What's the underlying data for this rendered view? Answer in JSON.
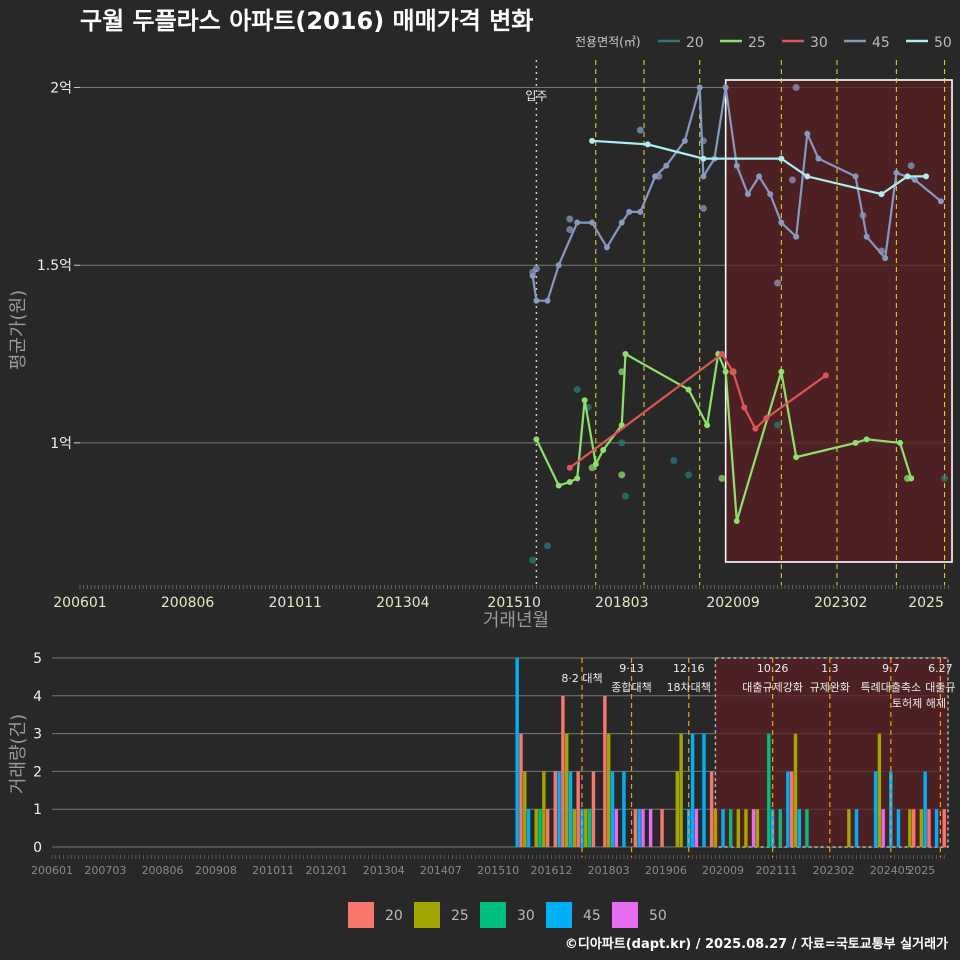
{
  "title": "구월 두플라스 아파트(2016) 매매가격 변화",
  "footer": "©디아파트(dapt.kr) / 2025.08.27 / 자료=국토교통부 실거래가",
  "colors": {
    "20": "#2a7a78",
    "25": "#8ee06a",
    "30": "#e05555",
    "45": "#8899c0",
    "50": "#aeeeee"
  },
  "bar_colors": {
    "20": "#f8766d",
    "25": "#a3a500",
    "30": "#00bf7d",
    "45": "#00b0f6",
    "50": "#e76bf3"
  },
  "chart_data": [
    {
      "type": "line",
      "title": "구월 두플라스 아파트(2016) 매매가격 변화",
      "xlabel": "거래년월",
      "ylabel": "평균가(원)",
      "x_ticks": [
        "200601",
        "200806",
        "201011",
        "201304",
        "201510",
        "201803",
        "202009",
        "202302",
        "2025"
      ],
      "y_ticks": [
        {
          "v": 1.0,
          "label": "1억"
        },
        {
          "v": 1.5,
          "label": "1.5억"
        },
        {
          "v": 2.0,
          "label": "2억"
        }
      ],
      "ylim": [
        0.6,
        2.1
      ],
      "legend": {
        "title": "전용면적(㎡)",
        "entries": [
          "20",
          "25",
          "30",
          "45",
          "50"
        ],
        "position": "top-right"
      },
      "annotation": {
        "label": "입주",
        "x": "2016-04"
      },
      "highlight_range": [
        "2020-07",
        "2025-08"
      ],
      "policy_lines": [
        "2017-08",
        "2018-09",
        "2019-12",
        "2021-10",
        "2023-01",
        "2024-05",
        "2025-06"
      ],
      "series": [
        {
          "name": "45",
          "points": [
            [
              "2016-03",
              1.47
            ],
            [
              "2016-04",
              1.4
            ],
            [
              "2016-07",
              1.4
            ],
            [
              "2016-10",
              1.5
            ],
            [
              "2017-03",
              1.62
            ],
            [
              "2017-07",
              1.62
            ],
            [
              "2017-11",
              1.55
            ],
            [
              "2018-03",
              1.62
            ],
            [
              "2018-05",
              1.65
            ],
            [
              "2018-08",
              1.65
            ],
            [
              "2018-12",
              1.75
            ],
            [
              "2019-03",
              1.78
            ],
            [
              "2019-08",
              1.85
            ],
            [
              "2019-12",
              2.0
            ],
            [
              "2020-01",
              1.75
            ],
            [
              "2020-04",
              1.8
            ],
            [
              "2020-07",
              2.0
            ],
            [
              "2020-10",
              1.78
            ],
            [
              "2021-01",
              1.7
            ],
            [
              "2021-04",
              1.75
            ],
            [
              "2021-07",
              1.7
            ],
            [
              "2021-10",
              1.62
            ],
            [
              "2022-02",
              1.58
            ],
            [
              "2022-05",
              1.87
            ],
            [
              "2022-08",
              1.8
            ],
            [
              "2023-06",
              1.75
            ],
            [
              "2023-09",
              1.58
            ],
            [
              "2024-02",
              1.52
            ],
            [
              "2024-05",
              1.76
            ],
            [
              "2024-10",
              1.74
            ],
            [
              "2025-05",
              1.68
            ]
          ]
        },
        {
          "name": "50",
          "points": [
            [
              "2017-07",
              1.85
            ],
            [
              "2018-10",
              1.84
            ],
            [
              "2020-01",
              1.8
            ],
            [
              "2021-10",
              1.8
            ],
            [
              "2022-05",
              1.75
            ],
            [
              "2024-01",
              1.7
            ],
            [
              "2024-08",
              1.75
            ],
            [
              "2025-01",
              1.75
            ]
          ]
        },
        {
          "name": "25",
          "points": [
            [
              "2016-04",
              1.01
            ],
            [
              "2016-10",
              0.88
            ],
            [
              "2017-01",
              0.89
            ],
            [
              "2017-03",
              0.9
            ],
            [
              "2017-05",
              1.12
            ],
            [
              "2017-08",
              0.94
            ],
            [
              "2017-10",
              0.98
            ],
            [
              "2018-03",
              1.05
            ],
            [
              "2018-04",
              1.25
            ],
            [
              "2019-09",
              1.15
            ],
            [
              "2020-02",
              1.05
            ],
            [
              "2020-05",
              1.25
            ],
            [
              "2020-07",
              1.2
            ],
            [
              "2020-10",
              0.78
            ],
            [
              "2021-10",
              1.2
            ],
            [
              "2022-02",
              0.96
            ],
            [
              "2023-06",
              1.0
            ],
            [
              "2023-09",
              1.01
            ],
            [
              "2024-06",
              1.0
            ],
            [
              "2024-09",
              0.9
            ]
          ]
        },
        {
          "name": "30",
          "points": [
            [
              "2017-01",
              0.93
            ],
            [
              "2020-06",
              1.25
            ],
            [
              "2020-09",
              1.2
            ],
            [
              "2020-12",
              1.1
            ],
            [
              "2021-03",
              1.04
            ],
            [
              "2021-06",
              1.07
            ],
            [
              "2022-10",
              1.19
            ]
          ]
        }
      ],
      "scatter_points": [
        [
          "2016-03",
          0.67,
          "20"
        ],
        [
          "2016-07",
          0.71,
          "20"
        ],
        [
          "2017-03",
          1.15,
          "20"
        ],
        [
          "2017-06",
          1.1,
          "20"
        ],
        [
          "2018-03",
          1.0,
          "20"
        ],
        [
          "2018-04",
          0.85,
          "20"
        ],
        [
          "2019-05",
          0.95,
          "20"
        ],
        [
          "2019-09",
          0.91,
          "20"
        ],
        [
          "2021-09",
          1.05,
          "20"
        ],
        [
          "2025-06",
          0.9,
          "20"
        ],
        [
          "2017-07",
          0.93,
          "25"
        ],
        [
          "2018-03",
          0.91,
          "25"
        ],
        [
          "2018-03",
          1.2,
          "25"
        ],
        [
          "2020-06",
          0.9,
          "25"
        ],
        [
          "2020-09",
          1.2,
          "25"
        ],
        [
          "2024-08",
          0.9,
          "25"
        ],
        [
          "2016-03",
          1.48,
          "45"
        ],
        [
          "2016-04",
          1.49,
          "45"
        ],
        [
          "2017-01",
          1.6,
          "45"
        ],
        [
          "2017-01",
          1.63,
          "45"
        ],
        [
          "2018-08",
          1.88,
          "45"
        ],
        [
          "2019-01",
          1.75,
          "45"
        ],
        [
          "2020-01",
          1.85,
          "45"
        ],
        [
          "2020-01",
          1.66,
          "45"
        ],
        [
          "2021-09",
          1.45,
          "45"
        ],
        [
          "2022-01",
          1.74,
          "45"
        ],
        [
          "2022-02",
          2.0,
          "45"
        ],
        [
          "2023-08",
          1.64,
          "45"
        ],
        [
          "2024-01",
          1.54,
          "45"
        ],
        [
          "2024-09",
          1.78,
          "45"
        ]
      ]
    },
    {
      "type": "bar",
      "ylabel": "거래량(건)",
      "x_ticks": [
        "200601",
        "200703",
        "200806",
        "200908",
        "201011",
        "201201",
        "201304",
        "201407",
        "201510",
        "201612",
        "201803",
        "201906",
        "202009",
        "202111",
        "202302",
        "202405",
        "2025"
      ],
      "ylim": [
        0,
        5
      ],
      "y_ticks": [
        0,
        1,
        2,
        3,
        4,
        5
      ],
      "legend": {
        "entries": [
          "20",
          "25",
          "30",
          "45",
          "50"
        ],
        "position": "bottom"
      },
      "policy_notes": [
        {
          "date": "2017-08",
          "line1": "8·2 대책",
          "line2": ""
        },
        {
          "date": "2018-09",
          "line1": "9·13",
          "line2": "종합대책"
        },
        {
          "date": "2019-12",
          "line1": "12·16",
          "line2": "18차대책"
        },
        {
          "date": "2021-10",
          "line1": "10.26",
          "line2": "대출규제강화"
        },
        {
          "date": "2023-01",
          "line1": "1.3",
          "line2": "규제완화"
        },
        {
          "date": "2024-05",
          "line1": "9.7",
          "line2": "특례대출축소"
        },
        {
          "date": "2025-06",
          "line1": "6.27",
          "line2": "대출규"
        }
      ],
      "extra_notes": [
        "토허제 해제"
      ],
      "bars": [
        [
          "2016-03",
          5,
          "45"
        ],
        [
          "2016-04",
          3,
          "20"
        ],
        [
          "2016-05",
          2,
          "25"
        ],
        [
          "2016-06",
          1,
          "45"
        ],
        [
          "2016-08",
          1,
          "25"
        ],
        [
          "2016-09",
          1,
          "30"
        ],
        [
          "2016-10",
          2,
          "25"
        ],
        [
          "2016-11",
          1,
          "20"
        ],
        [
          "2017-01",
          2,
          "20"
        ],
        [
          "2017-02",
          2,
          "45"
        ],
        [
          "2017-03",
          4,
          "20"
        ],
        [
          "2017-04",
          3,
          "25"
        ],
        [
          "2017-05",
          2,
          "45"
        ],
        [
          "2017-06",
          1,
          "25"
        ],
        [
          "2017-07",
          2,
          "20"
        ],
        [
          "2017-08",
          1,
          "45"
        ],
        [
          "2017-09",
          1,
          "25"
        ],
        [
          "2017-10",
          1,
          "30"
        ],
        [
          "2017-11",
          2,
          "20"
        ],
        [
          "2018-02",
          4,
          "20"
        ],
        [
          "2018-03",
          3,
          "25"
        ],
        [
          "2018-04",
          2,
          "45"
        ],
        [
          "2018-05",
          1,
          "50"
        ],
        [
          "2018-07",
          2,
          "45"
        ],
        [
          "2018-10",
          1,
          "20"
        ],
        [
          "2018-11",
          1,
          "45"
        ],
        [
          "2018-12",
          1,
          "50"
        ],
        [
          "2019-02",
          1,
          "50"
        ],
        [
          "2019-05",
          1,
          "20"
        ],
        [
          "2019-09",
          2,
          "25"
        ],
        [
          "2019-10",
          3,
          "25"
        ],
        [
          "2019-12",
          1,
          "45"
        ],
        [
          "2020-01",
          3,
          "45"
        ],
        [
          "2020-02",
          1,
          "50"
        ],
        [
          "2020-04",
          3,
          "45"
        ],
        [
          "2020-06",
          2,
          "20"
        ],
        [
          "2020-07",
          1,
          "25"
        ],
        [
          "2020-09",
          1,
          "45"
        ],
        [
          "2020-11",
          1,
          "30"
        ],
        [
          "2021-01",
          1,
          "25"
        ],
        [
          "2021-03",
          1,
          "25"
        ],
        [
          "2021-05",
          1,
          "50"
        ],
        [
          "2021-06",
          1,
          "25"
        ],
        [
          "2021-09",
          3,
          "30"
        ],
        [
          "2021-10",
          1,
          "45"
        ],
        [
          "2021-12",
          1,
          "30"
        ],
        [
          "2022-02",
          2,
          "45"
        ],
        [
          "2022-03",
          2,
          "20"
        ],
        [
          "2022-04",
          3,
          "25"
        ],
        [
          "2022-05",
          1,
          "45"
        ],
        [
          "2022-07",
          1,
          "30"
        ],
        [
          "2023-06",
          1,
          "25"
        ],
        [
          "2023-08",
          1,
          "45"
        ],
        [
          "2024-01",
          2,
          "45"
        ],
        [
          "2024-02",
          3,
          "25"
        ],
        [
          "2024-03",
          1,
          "50"
        ],
        [
          "2024-05",
          2,
          "45"
        ],
        [
          "2024-07",
          1,
          "45"
        ],
        [
          "2024-10",
          1,
          "25"
        ],
        [
          "2024-11",
          1,
          "20"
        ],
        [
          "2025-01",
          1,
          "25"
        ],
        [
          "2025-02",
          2,
          "45"
        ],
        [
          "2025-03",
          1,
          "20"
        ],
        [
          "2025-05",
          1,
          "45"
        ],
        [
          "2025-07",
          1,
          "20"
        ]
      ]
    }
  ]
}
